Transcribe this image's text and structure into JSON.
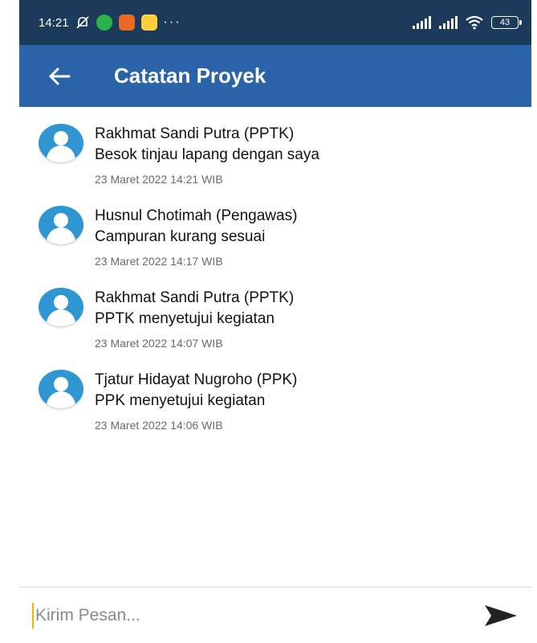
{
  "status_bar": {
    "time": "14:21",
    "more": "···",
    "battery": "43"
  },
  "app_bar": {
    "back_icon": "arrow-left-icon",
    "title": "Catatan Proyek"
  },
  "notes": [
    {
      "author": "Rakhmat Sandi Putra (PPTK)",
      "message": "Besok tinjau lapang dengan saya",
      "timestamp": "23 Maret 2022 14:21 WIB"
    },
    {
      "author": "Husnul Chotimah (Pengawas)",
      "message": "Campuran kurang sesuai",
      "timestamp": "23 Maret 2022 14:17 WIB"
    },
    {
      "author": "Rakhmat Sandi Putra (PPTK)",
      "message": "PPTK menyetujui kegiatan",
      "timestamp": "23 Maret 2022 14:07 WIB"
    },
    {
      "author": "Tjatur Hidayat Nugroho (PPK)",
      "message": "PPK menyetujui kegiatan",
      "timestamp": "23 Maret 2022 14:06 WIB"
    }
  ],
  "composer": {
    "placeholder": "Kirim Pesan...",
    "value": "",
    "send_icon": "send-icon"
  },
  "colors": {
    "status_bar": "#1c3a5a",
    "app_bar": "#2b63a8",
    "avatar": "#2f96d2"
  }
}
